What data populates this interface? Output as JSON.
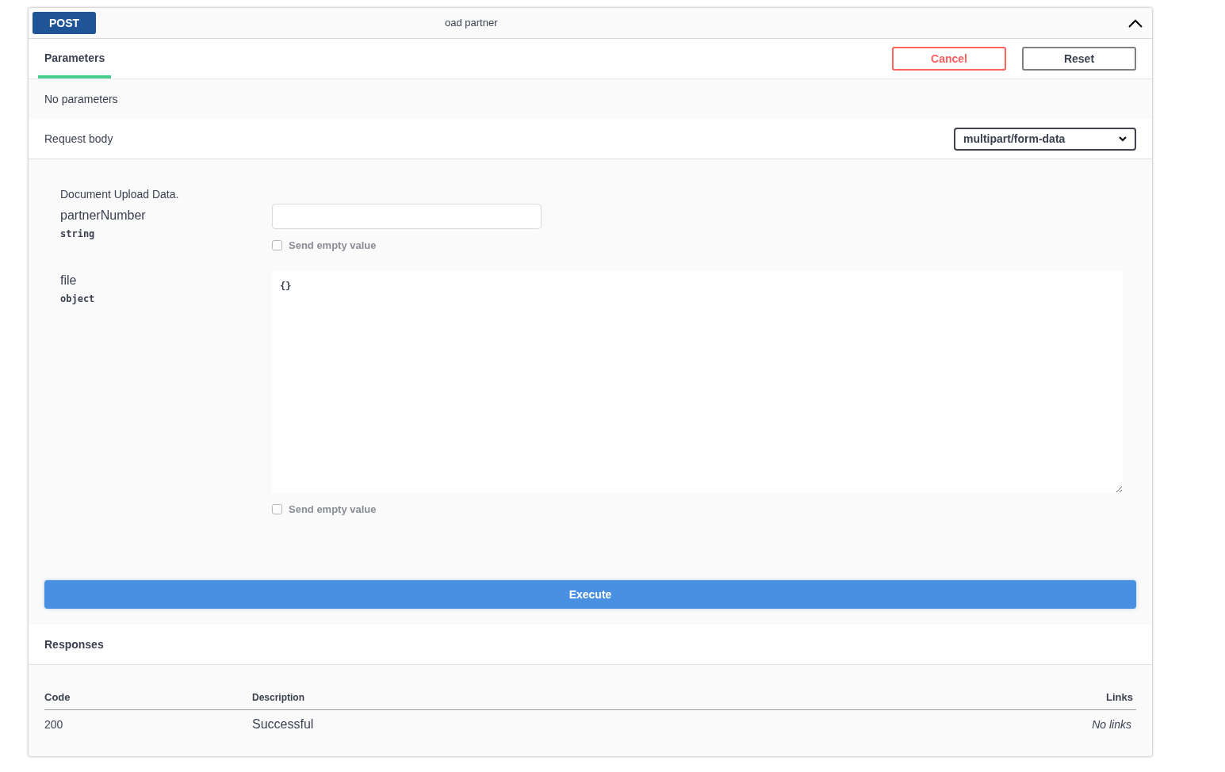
{
  "operation": {
    "method": "POST",
    "summary": "oad partner",
    "expanded": true
  },
  "tabs": [
    {
      "label": "Parameters",
      "selected": true
    }
  ],
  "buttons": [
    {
      "label": "Cancel",
      "kind": "cancel"
    },
    {
      "label": "Reset",
      "kind": "reset"
    }
  ],
  "parameters_message": "No parameters",
  "request_body": {
    "label": "Request body",
    "content_type": "multipart/form-data",
    "description": "Document Upload Data.",
    "fields": [
      {
        "name": "partnerNumber",
        "type": "string",
        "kind": "input",
        "send_empty": {
          "label": "Send empty value",
          "checked": false
        }
      },
      {
        "name": "file",
        "type": "object",
        "kind": "textarea",
        "value": "{}",
        "send_empty": {
          "label": "Send empty value",
          "checked": false
        }
      }
    ]
  },
  "execute_button": "Execute",
  "responses": {
    "title": "Responses",
    "columns": [
      "Code",
      "Description",
      "Links"
    ],
    "rows": [
      {
        "code": "200",
        "description": "Successful",
        "links": "No links"
      }
    ]
  }
}
